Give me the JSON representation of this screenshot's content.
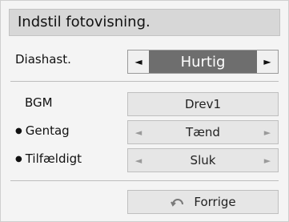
{
  "dialog": {
    "title": "Indstil fotovisning."
  },
  "rows": {
    "slideshow_speed": {
      "label": "Diashast.",
      "value": "Hurtig",
      "left_arrow": "◄",
      "right_arrow": "►"
    },
    "bgm": {
      "label": "BGM",
      "value": "Drev1"
    },
    "repeat": {
      "bullet": "●",
      "label": "Gentag",
      "value": "Tænd",
      "left_arrow": "◄",
      "right_arrow": "►"
    },
    "random": {
      "bullet": "●",
      "label": "Tilfældigt",
      "value": "Sluk",
      "left_arrow": "◄",
      "right_arrow": "►"
    }
  },
  "footer": {
    "back_label": "Forrige",
    "back_icon": "return-arrow-icon"
  },
  "colors": {
    "title_bar": "#d7d7d7",
    "selected_value_bg": "#6e6e6e",
    "control_bg": "#e6e6e6",
    "panel_bg": "#f4f4f4"
  }
}
